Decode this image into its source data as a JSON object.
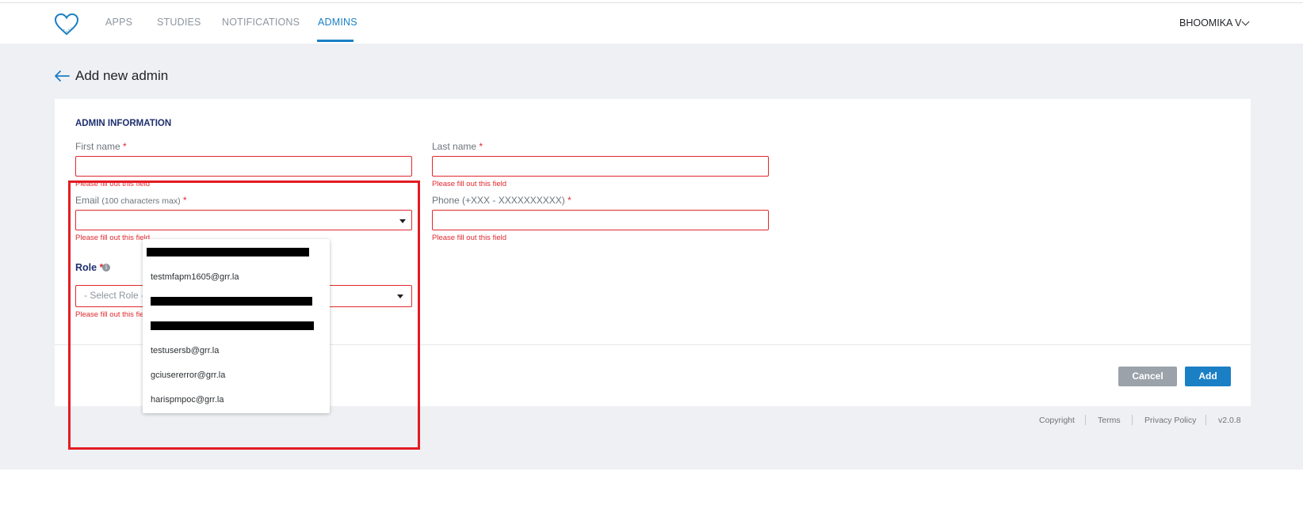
{
  "nav": {
    "items": [
      {
        "label": "APPS",
        "active": false
      },
      {
        "label": "STUDIES",
        "active": false
      },
      {
        "label": "NOTIFICATIONS",
        "active": false
      },
      {
        "label": "ADMINS",
        "active": true
      }
    ],
    "user_name": "BHOOMIKA V",
    "logo_icon": "heart-icon"
  },
  "page": {
    "title": "Add new admin"
  },
  "form": {
    "section_title": "ADMIN INFORMATION",
    "first_name_label": "First name",
    "last_name_label": "Last name",
    "email_label": "Email",
    "email_hint": "(100 characters max)",
    "phone_label": "Phone (+XXX - XXXXXXXXXX)",
    "role_label": "Role",
    "role_placeholder": "- Select Role -",
    "required_mark": "*",
    "error_text": "Please fill out this field",
    "first_name_value": "",
    "last_name_value": "",
    "email_value": "",
    "phone_value": ""
  },
  "email_suggestions": [
    "testmfapm1605@grr.la",
    "testusersb@grr.la",
    "gciusererror@grr.la",
    "harispmpoc@grr.la"
  ],
  "buttons": {
    "cancel": "Cancel",
    "add": "Add"
  },
  "footer": {
    "copyright": "Copyright",
    "terms": "Terms",
    "privacy": "Privacy Policy",
    "version": "v2.0.8"
  },
  "colors": {
    "accent": "#1a7fc4",
    "error": "#e0282e",
    "heading": "#1e2f6e",
    "highlight_box": "#e31b23"
  }
}
